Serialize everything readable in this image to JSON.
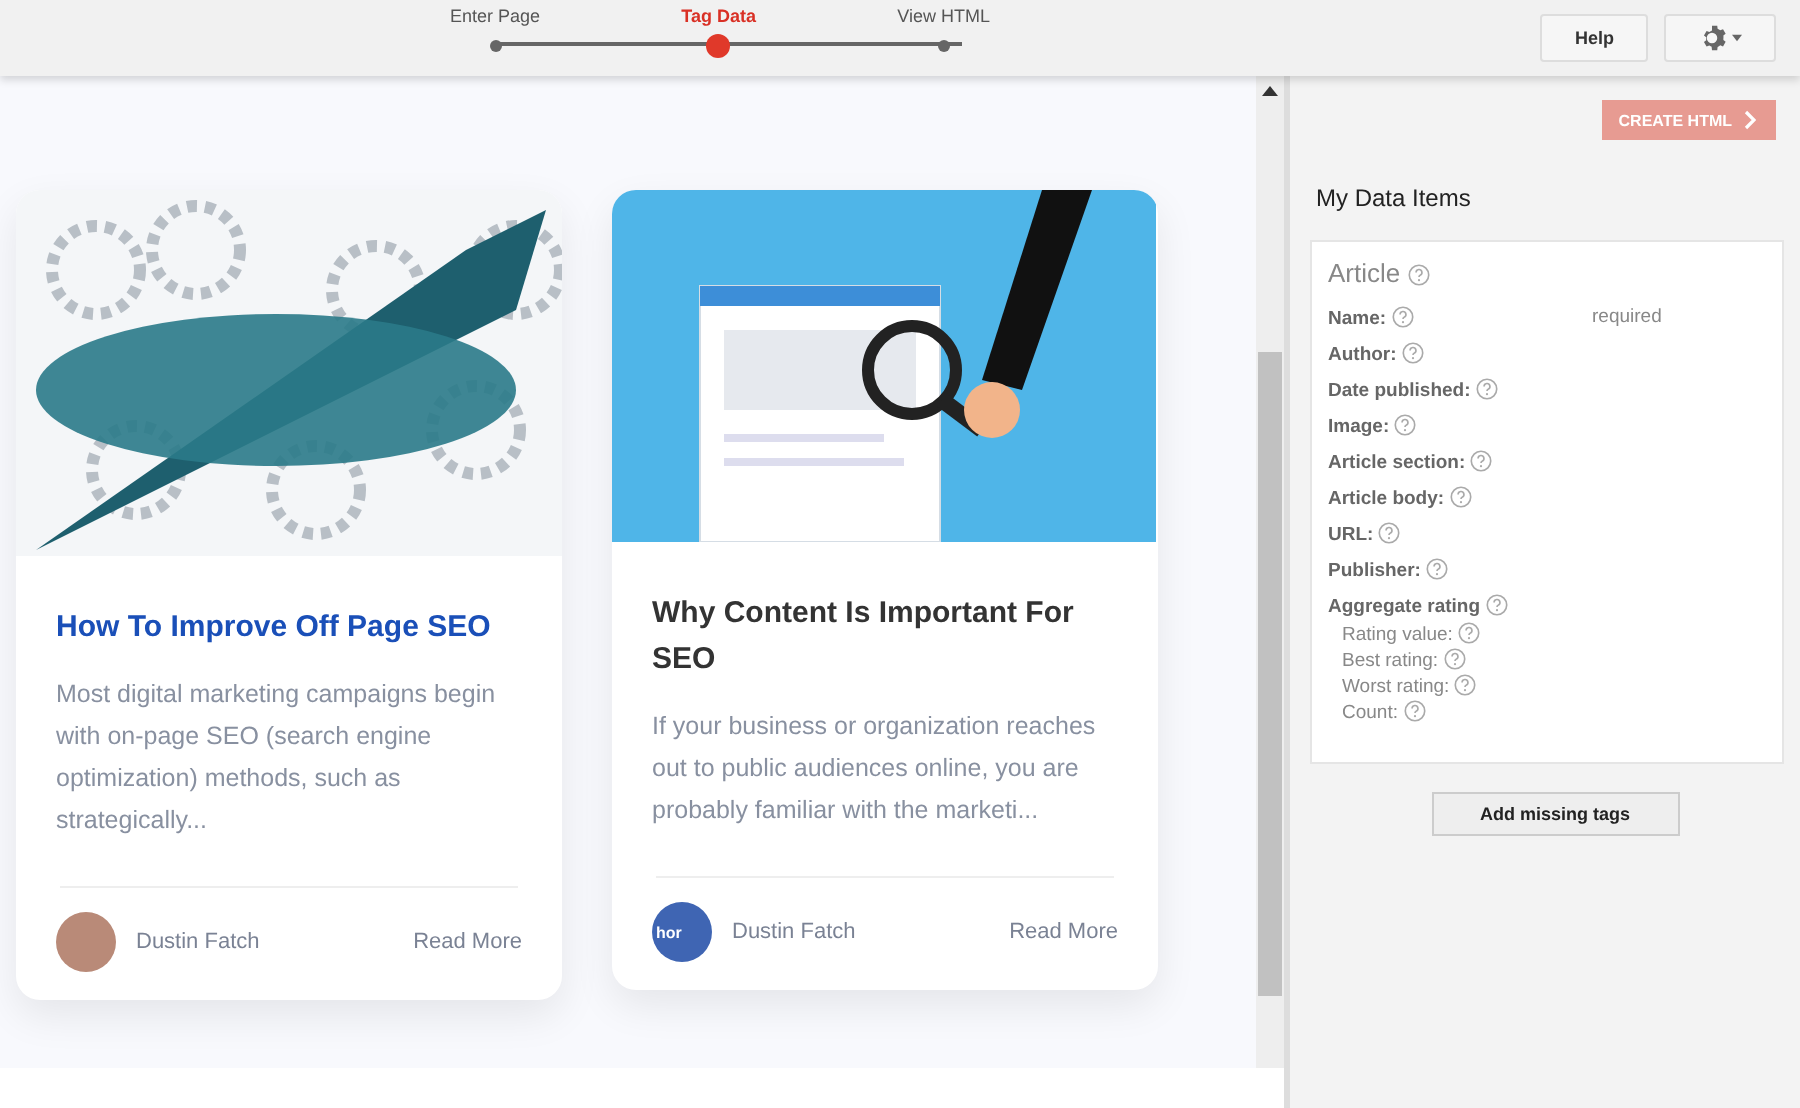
{
  "steps": [
    {
      "label": "Enter Page",
      "selected": false
    },
    {
      "label": "Tag Data",
      "selected": true
    },
    {
      "label": "View HTML",
      "selected": false
    }
  ],
  "toolbar": {
    "help": "Help"
  },
  "cards": [
    {
      "title": "How To Improve Off Page SEO",
      "title_link": true,
      "excerpt": "Most digital marketing campaigns begin with on-page SEO (search engine optimization) methods, such as strategically...",
      "author": "Dustin Fatch",
      "read_more": "Read More"
    },
    {
      "title": "Why Content Is Important For SEO",
      "title_link": false,
      "excerpt": "If your business or organization reaches out to public audiences online, you are probably familiar with the marketi...",
      "author": "Dustin Fatch",
      "avatar_alt": "hor",
      "read_more": "Read More"
    }
  ],
  "panel": {
    "create_button": "CREATE HTML",
    "title": "My Data Items",
    "section": "Article",
    "fields": [
      {
        "label": "Name:",
        "note": "required"
      },
      {
        "label": "Author:"
      },
      {
        "label": "Date published:"
      },
      {
        "label": "Image:"
      },
      {
        "label": "Article section:"
      },
      {
        "label": "Article body:"
      },
      {
        "label": "URL:"
      },
      {
        "label": "Publisher:"
      },
      {
        "label": "Aggregate rating",
        "children": [
          {
            "label": "Rating value:"
          },
          {
            "label": "Best rating:"
          },
          {
            "label": "Worst rating:"
          },
          {
            "label": "Count:"
          }
        ]
      }
    ],
    "add_button": "Add missing tags"
  }
}
